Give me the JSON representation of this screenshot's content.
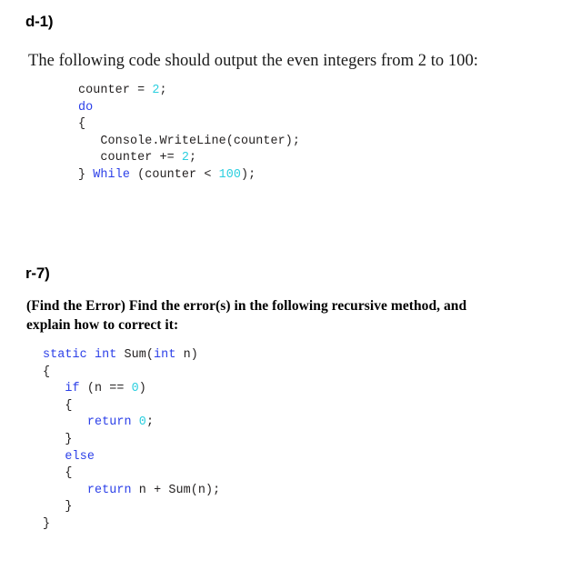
{
  "document": {
    "background_color": "#ffffff",
    "sections": [
      {
        "id": "d-1",
        "heading": "d-1)",
        "prompt": "The following code should output the even integers from 2 to 100:",
        "prompt_style": "regular",
        "code_lines": [
          [
            {
              "t": "counter = ",
              "c": "plain"
            },
            {
              "t": "2",
              "c": "number"
            },
            {
              "t": ";",
              "c": "plain"
            }
          ],
          [
            {
              "t": "do",
              "c": "keyword"
            }
          ],
          [
            {
              "t": "{",
              "c": "plain"
            }
          ],
          [
            {
              "t": "   Console.WriteLine(counter);",
              "c": "plain"
            }
          ],
          [
            {
              "t": "   counter += ",
              "c": "plain"
            },
            {
              "t": "2",
              "c": "number"
            },
            {
              "t": ";",
              "c": "plain"
            }
          ],
          [
            {
              "t": "} ",
              "c": "plain"
            },
            {
              "t": "While",
              "c": "keyword"
            },
            {
              "t": " (counter < ",
              "c": "plain"
            },
            {
              "t": "100",
              "c": "number"
            },
            {
              "t": ");",
              "c": "plain"
            }
          ]
        ]
      },
      {
        "id": "r-7",
        "heading": "r-7)",
        "prompt": "(Find the Error) Find the error(s) in the following recursive method, and explain how to correct it:",
        "prompt_style": "bold",
        "code_lines": [
          [
            {
              "t": "static int",
              "c": "keyword"
            },
            {
              "t": " Sum(",
              "c": "plain"
            },
            {
              "t": "int",
              "c": "keyword"
            },
            {
              "t": " n)",
              "c": "plain"
            }
          ],
          [
            {
              "t": "{",
              "c": "plain"
            }
          ],
          [
            {
              "t": "   ",
              "c": "plain"
            },
            {
              "t": "if",
              "c": "keyword"
            },
            {
              "t": " (n == ",
              "c": "plain"
            },
            {
              "t": "0",
              "c": "number"
            },
            {
              "t": ")",
              "c": "plain"
            }
          ],
          [
            {
              "t": "   {",
              "c": "plain"
            }
          ],
          [
            {
              "t": "      ",
              "c": "plain"
            },
            {
              "t": "return",
              "c": "keyword"
            },
            {
              "t": " ",
              "c": "plain"
            },
            {
              "t": "0",
              "c": "number"
            },
            {
              "t": ";",
              "c": "plain"
            }
          ],
          [
            {
              "t": "   }",
              "c": "plain"
            }
          ],
          [
            {
              "t": "   ",
              "c": "plain"
            },
            {
              "t": "else",
              "c": "keyword"
            }
          ],
          [
            {
              "t": "   {",
              "c": "plain"
            }
          ],
          [
            {
              "t": "      ",
              "c": "plain"
            },
            {
              "t": "return",
              "c": "keyword"
            },
            {
              "t": " n + Sum(n);",
              "c": "plain"
            }
          ],
          [
            {
              "t": "   }",
              "c": "plain"
            }
          ],
          [
            {
              "t": "}",
              "c": "plain"
            }
          ]
        ]
      }
    ],
    "syntax_colors": {
      "keyword": "#2B3FE8",
      "number": "#2BCFDF",
      "plain": "#221F1F"
    }
  }
}
